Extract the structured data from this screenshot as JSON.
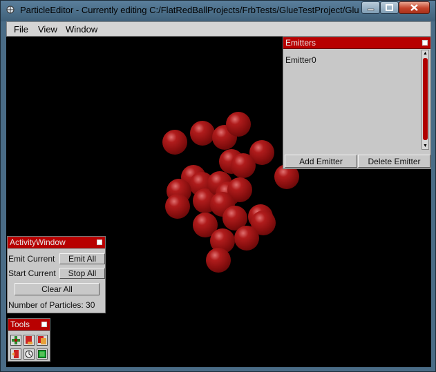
{
  "window": {
    "title": "ParticleEditor - Currently editing C:/FlatRedBallProjects/FrbTests/GlueTestProject/GlueTest..."
  },
  "menubar": {
    "items": [
      "File",
      "View",
      "Window"
    ]
  },
  "emitters_window": {
    "title": "Emitters",
    "items": [
      "Emitter0"
    ],
    "add_label": "Add Emitter",
    "delete_label": "Delete Emitter"
  },
  "activity_window": {
    "title": "ActivityWindow",
    "emit_current": "Emit Current",
    "emit_all": "Emit All",
    "start_current": "Start Current",
    "stop_all": "Stop All",
    "clear_all": "Clear All",
    "particle_count": "Number of Particles: 30"
  },
  "tools_window": {
    "title": "Tools",
    "icons": [
      "move-tool-icon",
      "emitter-add-icon",
      "emitter-copy-icon",
      "emitter-export-icon",
      "rotate-tool-icon",
      "scale-tool-icon"
    ]
  },
  "colors": {
    "accent": "#b80000",
    "particle": "#8a0f0f",
    "background": "#000000"
  }
}
